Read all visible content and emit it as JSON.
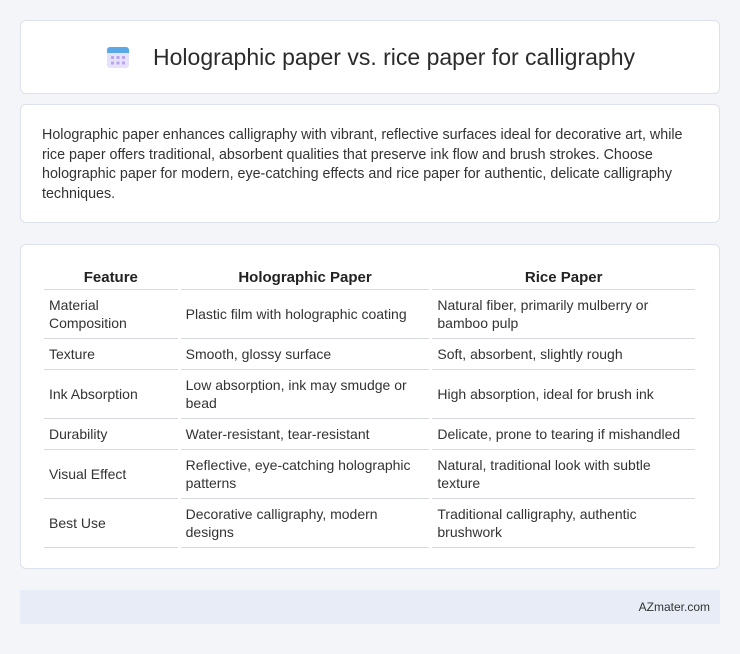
{
  "header": {
    "title": "Holographic paper vs. rice paper for calligraphy",
    "icon": "calendar-icon"
  },
  "summary": {
    "text": "Holographic paper enhances calligraphy with vibrant, reflective surfaces ideal for decorative art, while rice paper offers traditional, absorbent qualities that preserve ink flow and brush strokes. Choose holographic paper for modern, eye-catching effects and rice paper for authentic, delicate calligraphy techniques."
  },
  "table": {
    "headers": [
      "Feature",
      "Holographic Paper",
      "Rice Paper"
    ],
    "rows": [
      [
        "Material Composition",
        "Plastic film with holographic coating",
        "Natural fiber, primarily mulberry or bamboo pulp"
      ],
      [
        "Texture",
        "Smooth, glossy surface",
        "Soft, absorbent, slightly rough"
      ],
      [
        "Ink Absorption",
        "Low absorption, ink may smudge or bead",
        "High absorption, ideal for brush ink"
      ],
      [
        "Durability",
        "Water-resistant, tear-resistant",
        "Delicate, prone to tearing if mishandled"
      ],
      [
        "Visual Effect",
        "Reflective, eye-catching holographic patterns",
        "Natural, traditional look with subtle texture"
      ],
      [
        "Best Use",
        "Decorative calligraphy, modern designs",
        "Traditional calligraphy, authentic brushwork"
      ]
    ]
  },
  "footer": {
    "brand": "AZmater.com"
  }
}
